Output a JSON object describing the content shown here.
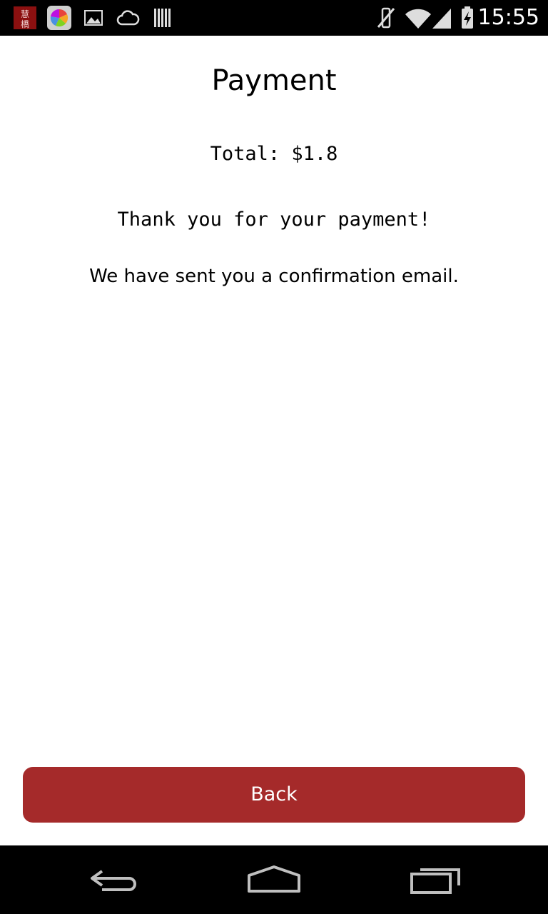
{
  "status_bar": {
    "time": "15:55",
    "app_icon_text": "慧橋",
    "icons": [
      "app-icon",
      "color-wheel-icon",
      "image-icon",
      "cloud-icon",
      "barcode-icon",
      "mute-icon",
      "wifi-icon",
      "signal-icon",
      "battery-charging-icon"
    ]
  },
  "payment": {
    "title": "Payment",
    "total": "Total: $1.8",
    "thank_you": "Thank you for your payment!",
    "confirmation": "We have sent you a confirmation email."
  },
  "actions": {
    "back_label": "Back"
  },
  "nav_bar": {
    "buttons": [
      "back-nav-icon",
      "home-nav-icon",
      "recents-nav-icon"
    ]
  },
  "colors": {
    "accent": "#a52a2a",
    "bars": "#000000",
    "background": "#ffffff"
  }
}
